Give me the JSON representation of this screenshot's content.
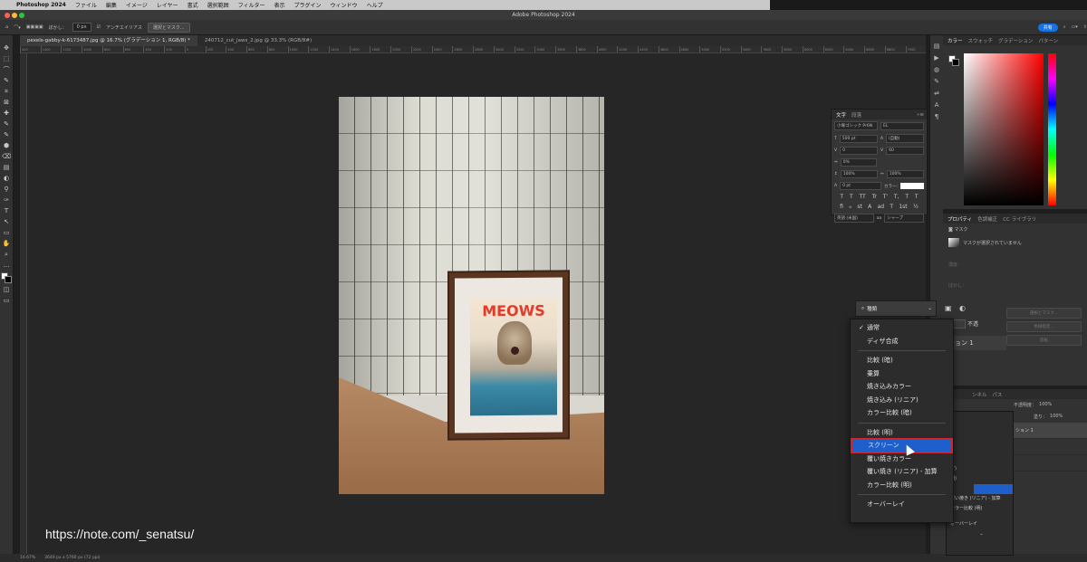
{
  "menubar": {
    "app": "Photoshop 2024",
    "items": [
      "ファイル",
      "編集",
      "イメージ",
      "レイヤー",
      "書式",
      "選択範囲",
      "フィルター",
      "表示",
      "プラグイン",
      "ウィンドウ",
      "ヘルプ"
    ]
  },
  "window": {
    "title": "Adobe Photoshop 2024"
  },
  "options_bar": {
    "feather_label": "ぼかし：",
    "feather_value": "0 px",
    "antialias_label": "アンチエイリアス",
    "select_mask_button": "選択とマスク...",
    "share_button": "共有"
  },
  "tabs": [
    {
      "label": "pexels-gabby-k-6173487.jpg @ 16.7% (グラデーション 1, RGB/8) *",
      "active": true
    },
    {
      "label": "240712_cut_jaws_2.jpg @ 33.3% (RGB/8#)",
      "active": false
    }
  ],
  "ruler_ticks": [
    "400",
    "1400",
    "1200",
    "1000",
    "800",
    "600",
    "400",
    "200",
    "0",
    "200",
    "400",
    "600",
    "800",
    "1000",
    "1200",
    "1400",
    "1600",
    "1800",
    "2000",
    "2200",
    "2400",
    "2600",
    "2800",
    "3000",
    "3200",
    "3400",
    "3600",
    "3800",
    "4000",
    "4200",
    "4400",
    "4600",
    "4800",
    "5000",
    "5200",
    "5400",
    "5600",
    "5800",
    "6000",
    "6200",
    "6400",
    "6600",
    "6800",
    "7000"
  ],
  "tools": [
    "✥",
    "⬚",
    "⌒",
    "✎",
    "⌗",
    "⊠",
    "✚",
    "✎",
    "✎",
    "⬢",
    "⌫",
    "▤",
    "◐",
    "⚲",
    "✑",
    "T",
    "↖",
    "▭",
    "✋",
    "⌕",
    "…"
  ],
  "poster": {
    "title": "MEOWS"
  },
  "character_panel": {
    "tabs": [
      "文字",
      "段落"
    ],
    "font": "小塚ゴシック Pr6N",
    "weight": "EL",
    "size": "500 pt",
    "leading": "(自動)",
    "tracking": "0",
    "kerning": "60",
    "scale_label": "0%",
    "vscale": "100%",
    "hscale": "100%",
    "baseline": "0 pt",
    "color_label": "カラー:",
    "type_buttons": [
      "T",
      "T",
      "TT",
      "Tr",
      "T'",
      "T,",
      "T",
      "T"
    ],
    "lang": "英語 (米国)",
    "aa": "シャープ"
  },
  "color_panel": {
    "tabs": [
      "カラー",
      "スウォッチ",
      "グラデーション",
      "パターン"
    ]
  },
  "properties_panel": {
    "tabs": [
      "プロパティ",
      "色調補正",
      "CC ライブラリ"
    ],
    "section": "マスク",
    "mask_status": "マスクが選択されていません",
    "density_label": "濃度：",
    "feather_label": "ぼかし：",
    "buttons": [
      "選択とマスク...",
      "色域指定...",
      "反転"
    ]
  },
  "layers_panel": {
    "tabs": [
      "ンネル",
      "パス"
    ],
    "opacity_label": "不透明度：",
    "opacity": "100%",
    "fill_label": "塗り：",
    "fill": "100%",
    "partial_label": "不透",
    "partial_layer": "ション 1",
    "layer_names": [
      "ション 1"
    ]
  },
  "blend_dropdown": {
    "search_label": "種類",
    "items": [
      {
        "label": "通常",
        "checked": true,
        "group": 1
      },
      {
        "label": "ディザ合成",
        "group": 1
      },
      {
        "label": "比較 (暗)",
        "group": 2
      },
      {
        "label": "乗算",
        "group": 2
      },
      {
        "label": "焼き込みカラー",
        "group": 2
      },
      {
        "label": "焼き込み (リニア)",
        "group": 2
      },
      {
        "label": "カラー比較 (暗)",
        "group": 2
      },
      {
        "label": "比較 (明)",
        "group": 3
      },
      {
        "label": "スクリーン",
        "group": 3,
        "selected": true
      },
      {
        "label": "覆い焼きカラー",
        "group": 3
      },
      {
        "label": "覆い焼き (リニア) - 加算",
        "group": 3
      },
      {
        "label": "カラー比較 (明)",
        "group": 3
      },
      {
        "label": "オーバーレイ",
        "group": 4
      }
    ]
  },
  "second_menu": {
    "items": [
      "ア)",
      "明)",
      "覆い焼き (リニア) - 加算",
      "カラー比較 (明)",
      "オーバーレイ"
    ]
  },
  "status": {
    "zoom": "16.67%",
    "dims": "3649 px x 5760 px (72 ppi)"
  },
  "watermark": "https://note.com/_senatsu/"
}
